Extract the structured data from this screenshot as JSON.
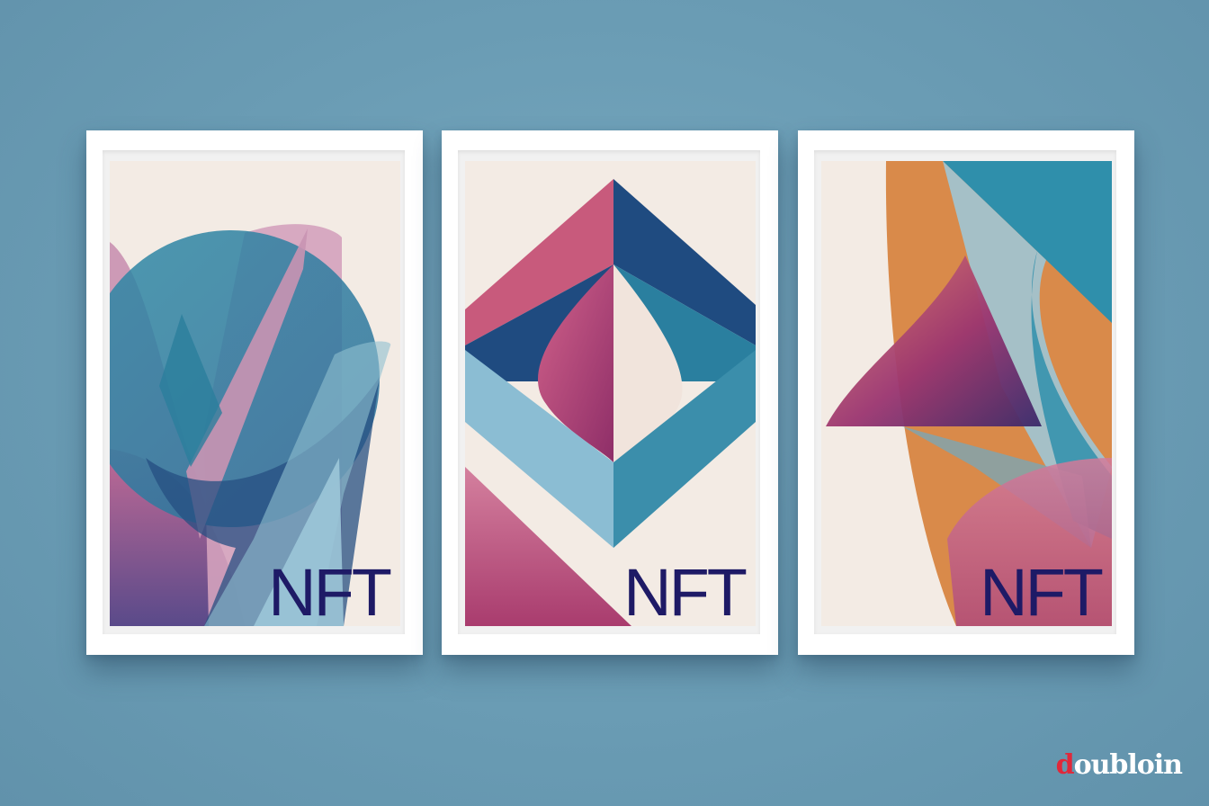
{
  "artworks": [
    {
      "label": "NFT"
    },
    {
      "label": "NFT"
    },
    {
      "label": "NFT"
    }
  ],
  "watermark": {
    "accent": "d",
    "text": "oubloin"
  },
  "colors": {
    "wall": "#6b9db5",
    "frame": "#ffffff",
    "canvas": "#f3ebe4",
    "label": "#1e1a66",
    "watermark_accent": "#e0283a"
  }
}
